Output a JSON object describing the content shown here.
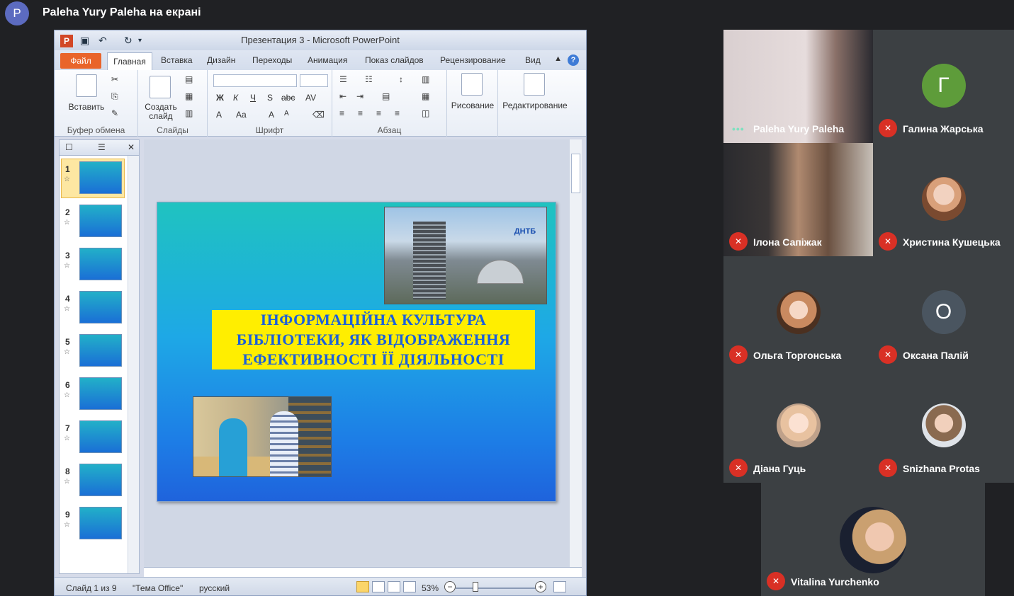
{
  "presenter": {
    "avatar_letter": "P",
    "banner": "Paleha Yury Paleha на екрані"
  },
  "ppt": {
    "window_title": "Презентация 3  -  Microsoft PowerPoint",
    "tabs": {
      "file": "Файл",
      "home": "Главная",
      "insert": "Вставка",
      "design": "Дизайн",
      "transitions": "Переходы",
      "animations": "Анимация",
      "slideshow": "Показ слайдов",
      "review": "Рецензирование",
      "view": "Вид"
    },
    "ribbon": {
      "paste": "Вставить",
      "new_slide_line1": "Создать",
      "new_slide_line2": "слайд",
      "drawing": "Рисование",
      "editing": "Редактирование",
      "groups": {
        "clipboard": "Буфер обмена",
        "slides": "Слайды",
        "font": "Шрифт",
        "paragraph": "Абзац"
      },
      "font_buttons": {
        "bold": "Ж",
        "italic": "К",
        "underline": "Ч",
        "shadow": "S",
        "strike": "abc",
        "spacing": "AV",
        "font_color": "A",
        "case": "Aa",
        "grow": "A",
        "shrink": "A"
      }
    },
    "thumbnails": [
      "1",
      "2",
      "3",
      "4",
      "5",
      "6",
      "7",
      "8",
      "9"
    ],
    "selected_thumbnail": "1",
    "slide": {
      "title_lines": [
        "ІНФОРМАЦІЙНА КУЛЬТУРА",
        "БІБЛІОТЕКИ,  ЯК  ВІДОБРАЖЕННЯ",
        "ЕФЕКТИВНОСТІ  ЇЇ  ДІЯЛЬНОСТІ"
      ],
      "logo_text": "ДНТБ"
    },
    "status": {
      "slide_counter": "Слайд 1 из 9",
      "theme": "\"Тема Office\"",
      "language": "русский",
      "zoom": "53%"
    }
  },
  "participants": [
    {
      "name": "Paleha Yury Paleha",
      "type": "video",
      "muted": false
    },
    {
      "name": "Галина Жарська",
      "type": "letter",
      "letter": "Г",
      "color": "#5e9c3a",
      "muted": true
    },
    {
      "name": "Ілона Сапіжак",
      "type": "video",
      "muted": true
    },
    {
      "name": "Христина Кушецька",
      "type": "photo",
      "muted": true
    },
    {
      "name": "Ольга Торгонська",
      "type": "photo",
      "muted": true
    },
    {
      "name": "Оксана Палій",
      "type": "letter",
      "letter": "О",
      "color": "#4a5560",
      "muted": true
    },
    {
      "name": "Діана Гуць",
      "type": "photo",
      "muted": true
    },
    {
      "name": "Snizhana Protas",
      "type": "photo",
      "muted": true
    },
    {
      "name": "Vitalina Yurchenko",
      "type": "photo",
      "muted": true
    }
  ],
  "colors": {
    "meet_bg": "#202124",
    "tile_bg": "#3c4043",
    "mute_red": "#d93025",
    "slide_title_yellow": "#ffee00",
    "slide_title_blue": "#1b5fd9"
  }
}
